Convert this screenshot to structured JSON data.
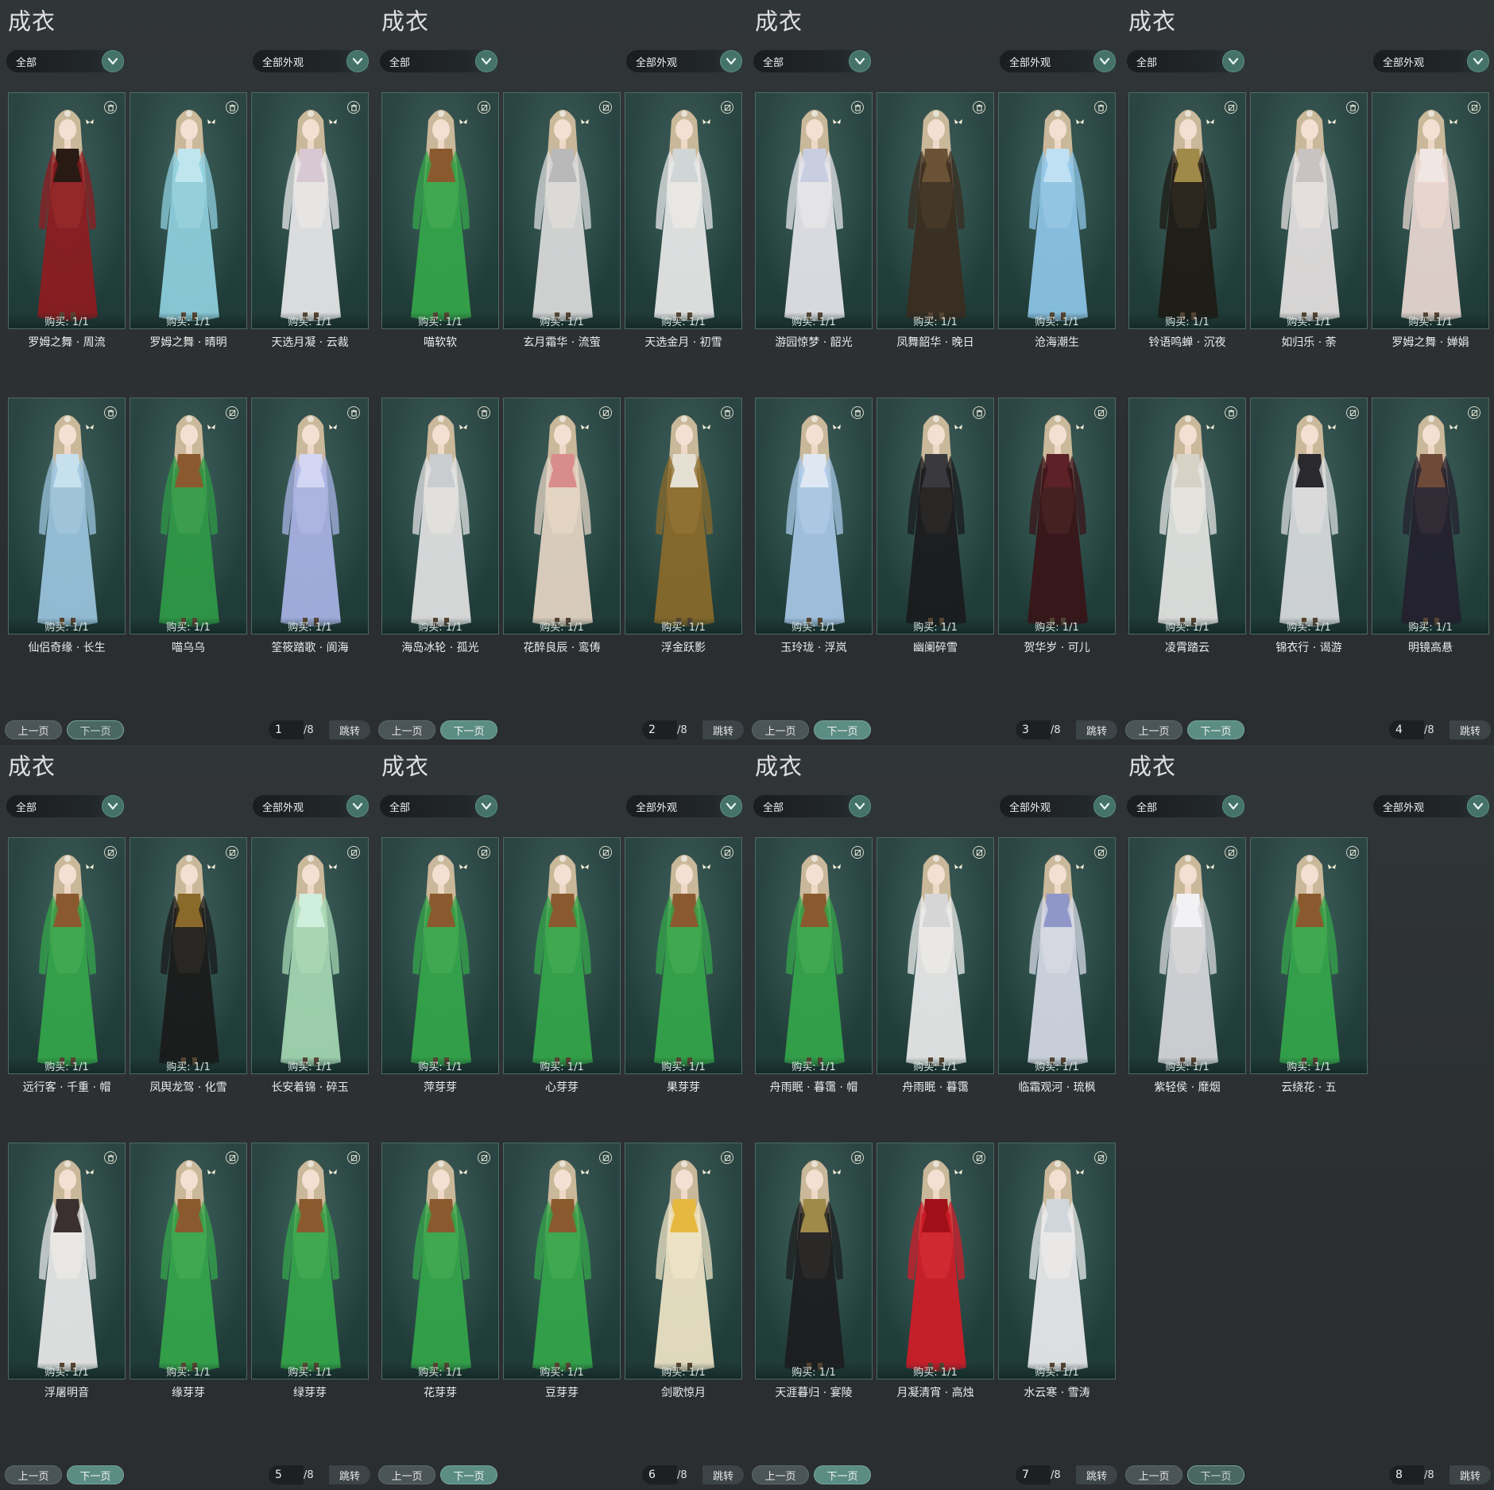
{
  "ui": {
    "panel_title": "成衣",
    "category_filter": "全部",
    "appearance_filter": "全部外观",
    "prev_label": "上一页",
    "next_label": "下一页",
    "jump_label": "跳转",
    "total_pages": "/8"
  },
  "colors": {
    "background": "#2c3032",
    "card_bg": "#24423f",
    "card_border": "#4e6a65",
    "accent_teal": "#5b8d84"
  },
  "panels": [
    {
      "page": "1",
      "items": [
        {
          "name": "罗姆之舞 · 周流",
          "buy": "购买: 1/1",
          "badge": "trash-icon",
          "outfit": "#8e1b1f",
          "accent": "#2a1a14"
        },
        {
          "name": "罗姆之舞 · 晴明",
          "buy": "购买: 1/1",
          "badge": "trash-icon",
          "outfit": "#8fd0e0",
          "accent": "#bfe6ef"
        },
        {
          "name": "天选月凝 · 云裁",
          "buy": "购买: 1/1",
          "badge": "trash-icon",
          "outfit": "#e9e8ea",
          "accent": "#d8c8d4"
        },
        {
          "name": "仙侣奇缘 · 长生",
          "buy": "购买: 1/1",
          "badge": "trash-icon",
          "outfit": "#9bc4de",
          "accent": "#c7e0ee"
        },
        {
          "name": "喵乌乌",
          "buy": "购买: 1/1",
          "badge": "no-trade-icon",
          "outfit": "#2f9a46",
          "accent": "#8a5a2e"
        },
        {
          "name": "筌筱踏歌 · 阆海",
          "buy": "购买: 1/1",
          "badge": "trash-icon",
          "outfit": "#a9b3e6",
          "accent": "#d2d6f2"
        }
      ]
    },
    {
      "page": "2",
      "items": [
        {
          "name": "喵软软",
          "buy": "购买: 1/1",
          "badge": "no-trade-icon",
          "outfit": "#34a64a",
          "accent": "#8a5a2e"
        },
        {
          "name": "玄月霜华 · 流萤",
          "buy": "购买: 1/1",
          "badge": "no-trade-icon",
          "outfit": "#dcdcdc",
          "accent": "#b9b9b9"
        },
        {
          "name": "天选金月 · 初雪",
          "buy": "购买: 1/1",
          "badge": "no-trade-icon",
          "outfit": "#eaeaea",
          "accent": "#d0d6d6"
        },
        {
          "name": "海岛冰轮 · 孤光",
          "buy": "购买: 1/1",
          "badge": "trash-icon",
          "outfit": "#e3e3e3",
          "accent": "#c9cdd0"
        },
        {
          "name": "花醉良辰 · 鸾俦",
          "buy": "购买: 1/1",
          "badge": "no-trade-icon",
          "outfit": "#e6d6c6",
          "accent": "#d98c8c"
        },
        {
          "name": "浮金跃影",
          "buy": "购买: 1/1",
          "badge": "trash-icon",
          "outfit": "#8a6a2a",
          "accent": "#e6e0d2"
        }
      ]
    },
    {
      "page": "3",
      "items": [
        {
          "name": "游园惊梦 · 韶光",
          "buy": "购买: 1/1",
          "badge": "trash-icon",
          "outfit": "#e6e6ec",
          "accent": "#c8cee0"
        },
        {
          "name": "凤舞韶华 · 晚日",
          "buy": "购买: 1/1",
          "badge": "trash-icon",
          "outfit": "#3b2c20",
          "accent": "#6a5236"
        },
        {
          "name": "沧海潮生",
          "buy": "购买: 1/1",
          "badge": "trash-icon",
          "outfit": "#8ec6e8",
          "accent": "#bfe0f2"
        },
        {
          "name": "玉玲珑 · 浮岚",
          "buy": "购买: 1/1",
          "badge": "trash-icon",
          "outfit": "#a8c8e8",
          "accent": "#dfe8f2"
        },
        {
          "name": "幽阑碎雪",
          "buy": "购买: 1/1",
          "badge": "trash-icon",
          "outfit": "#1a1a1c",
          "accent": "#3a3a3e"
        },
        {
          "name": "贺华岁 · 可儿",
          "buy": "购买: 1/1",
          "badge": "no-trade-icon",
          "outfit": "#3a1418",
          "accent": "#5c2228"
        }
      ]
    },
    {
      "page": "4",
      "items": [
        {
          "name": "铃语鸣蝉 · 沉夜",
          "buy": "购买: 1/1",
          "badge": "no-trade-icon",
          "outfit": "#1e1a14",
          "accent": "#a08a4a"
        },
        {
          "name": "如归乐 · 荼",
          "buy": "购买: 1/1",
          "badge": "trash-icon",
          "outfit": "#e6e2e2",
          "accent": "#c8c2c2"
        },
        {
          "name": "罗姆之舞 · 婵娟",
          "buy": "购买: 1/1",
          "badge": "no-trade-icon",
          "outfit": "#ead8d2",
          "accent": "#f0e6e2"
        },
        {
          "name": "凌霄踏云",
          "buy": "购买: 1/1",
          "badge": "trash-icon",
          "outfit": "#e6e6e4",
          "accent": "#d6d2c6"
        },
        {
          "name": "锦衣行 · 谒游",
          "buy": "购买: 1/1",
          "badge": "no-trade-icon",
          "outfit": "#dadcde",
          "accent": "#2a2a2e"
        },
        {
          "name": "明镜高悬",
          "buy": "购买: 1/1",
          "badge": "no-trade-icon",
          "outfit": "#24202e",
          "accent": "#6e4a3a"
        }
      ]
    },
    {
      "page": "5",
      "items": [
        {
          "name": "远行客 · 千重 · 帽",
          "buy": "购买: 1/1",
          "badge": "no-trade-icon",
          "outfit": "#34a64a",
          "accent": "#8a5a2e"
        },
        {
          "name": "凤舆龙驾 · 化雪",
          "buy": "购买: 1/1",
          "badge": "no-trade-icon",
          "outfit": "#1a1a1a",
          "accent": "#8a6a2a"
        },
        {
          "name": "长安着锦 · 碎玉",
          "buy": "购买: 1/1",
          "badge": "no-trade-icon",
          "outfit": "#a6d8b4",
          "accent": "#d0eedc"
        },
        {
          "name": "浮屠明音",
          "buy": "购买: 1/1",
          "badge": "trash-icon",
          "outfit": "#eaeaea",
          "accent": "#3a3030"
        },
        {
          "name": "缘芽芽",
          "buy": "购买: 1/1",
          "badge": "no-trade-icon",
          "outfit": "#34a64a",
          "accent": "#8a5a2e"
        },
        {
          "name": "绿芽芽",
          "buy": "购买: 1/1",
          "badge": "no-trade-icon",
          "outfit": "#34a64a",
          "accent": "#8a5a2e"
        }
      ]
    },
    {
      "page": "6",
      "items": [
        {
          "name": "萍芽芽",
          "buy": "购买: 1/1",
          "badge": "no-trade-icon",
          "outfit": "#34a64a",
          "accent": "#8a5a2e"
        },
        {
          "name": "心芽芽",
          "buy": "购买: 1/1",
          "badge": "no-trade-icon",
          "outfit": "#34a64a",
          "accent": "#8a5a2e"
        },
        {
          "name": "果芽芽",
          "buy": "购买: 1/1",
          "badge": "no-trade-icon",
          "outfit": "#34a64a",
          "accent": "#8a5a2e"
        },
        {
          "name": "花芽芽",
          "buy": "购买: 1/1",
          "badge": "no-trade-icon",
          "outfit": "#34a64a",
          "accent": "#8a5a2e"
        },
        {
          "name": "豆芽芽",
          "buy": "购买: 1/1",
          "badge": "no-trade-icon",
          "outfit": "#34a64a",
          "accent": "#8a5a2e"
        },
        {
          "name": "剑歌惊月",
          "buy": "购买: 1/1",
          "badge": "no-trade-icon",
          "outfit": "#f0e6c8",
          "accent": "#e6b840"
        }
      ]
    },
    {
      "page": "7",
      "items": [
        {
          "name": "舟雨眠 · 暮霭 · 帽",
          "buy": "购买: 1/1",
          "badge": "no-trade-icon",
          "outfit": "#34a64a",
          "accent": "#8a5a2e"
        },
        {
          "name": "舟雨眠 · 暮霭",
          "buy": "购买: 1/1",
          "badge": "no-trade-icon",
          "outfit": "#ececec",
          "accent": "#d6d6d6"
        },
        {
          "name": "临霜观河 · 琉枫",
          "buy": "购买: 1/1",
          "badge": "no-trade-icon",
          "outfit": "#d6dae6",
          "accent": "#8f96c8"
        },
        {
          "name": "天涯暮归 · 宴陵",
          "buy": "购买: 1/1",
          "badge": "no-trade-icon",
          "outfit": "#1c1c1e",
          "accent": "#a08a4a"
        },
        {
          "name": "月凝清宵 · 高烛",
          "buy": "购买: 1/1",
          "badge": "no-trade-icon",
          "outfit": "#d01c28",
          "accent": "#a01018"
        },
        {
          "name": "水云寒 · 雪涛",
          "buy": "购买: 1/1",
          "badge": "no-trade-icon",
          "outfit": "#ececee",
          "accent": "#d0d6dc"
        }
      ]
    },
    {
      "page": "8",
      "items": [
        {
          "name": "紫轻侯 · 靡烟",
          "buy": "购买: 1/1",
          "badge": "no-trade-icon",
          "outfit": "#d8d8dc",
          "accent": "#f2f2f4"
        },
        {
          "name": "云绕花 · 五",
          "buy": "购买: 1/1",
          "badge": "no-trade-icon",
          "outfit": "#34a64a",
          "accent": "#8a5a2e"
        }
      ]
    }
  ]
}
